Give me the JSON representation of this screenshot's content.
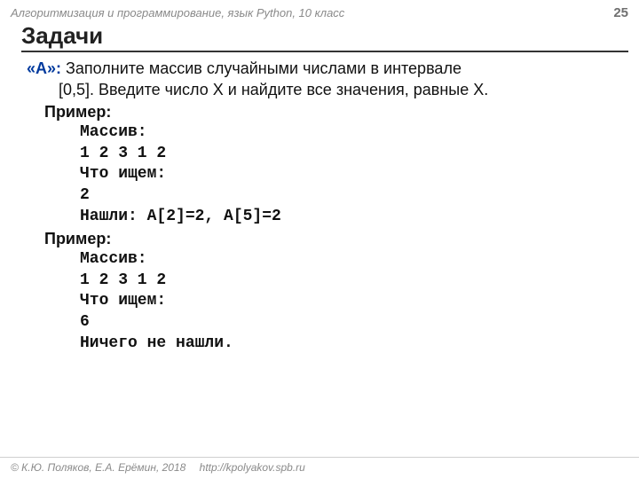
{
  "header": {
    "left": "Алгоритмизация и программирование, язык Python, 10 класс",
    "pageNumber": "25"
  },
  "title": "Задачи",
  "task": {
    "label": "«A»:",
    "textLine1": " Заполните массив случайными числами в интервале",
    "textLine2": "[0,5]. Введите число X и найдите все значения, равные X.",
    "example1": {
      "heading": "Пример",
      "lines": "Массив:\n1 2 3 1 2\nЧто ищем:\n2\nНашли: A[2]=2, A[5]=2"
    },
    "example2": {
      "heading": "Пример",
      "lines": "Массив:\n1 2 3 1 2\nЧто ищем:\n6\nНичего не нашли."
    }
  },
  "footer": {
    "copyright": "© К.Ю. Поляков, Е.А. Ерёмин, 2018",
    "url": "http://kpolyakov.spb.ru"
  }
}
